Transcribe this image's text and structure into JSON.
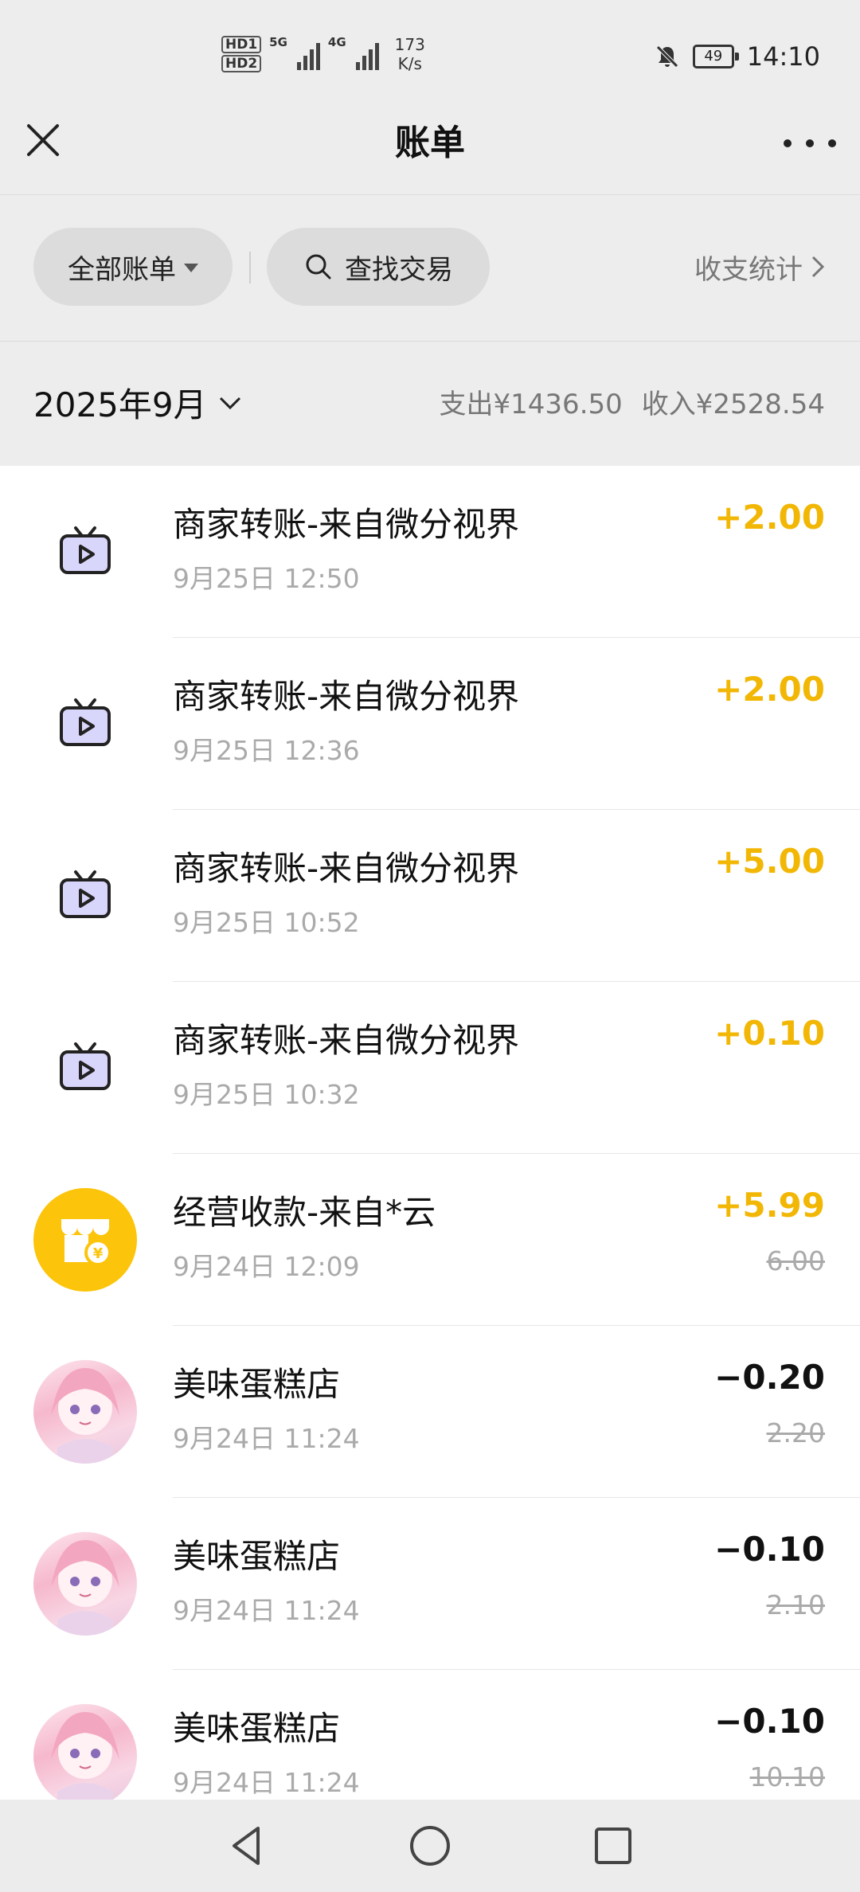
{
  "status_bar": {
    "hd1": "HD1",
    "hd2": "HD2",
    "net1": "5G",
    "net2": "4G",
    "speed_value": "173",
    "speed_unit": "K/s",
    "battery": "49",
    "time": "14:10"
  },
  "header": {
    "title": "账单"
  },
  "filters": {
    "all_bills": "全部账单",
    "search": "查找交易",
    "stats": "收支统计"
  },
  "summary": {
    "month": "2025年9月",
    "expense": "支出¥1436.50",
    "income": "收入¥2528.54"
  },
  "transactions": [
    {
      "name": "商家转账-来自微分视界",
      "time": "9月25日 12:50",
      "amount": "+2.00",
      "original": "",
      "icon": "tv-play-icon"
    },
    {
      "name": "商家转账-来自微分视界",
      "time": "9月25日 12:36",
      "amount": "+2.00",
      "original": "",
      "icon": "tv-play-icon"
    },
    {
      "name": "商家转账-来自微分视界",
      "time": "9月25日 10:52",
      "amount": "+5.00",
      "original": "",
      "icon": "tv-play-icon"
    },
    {
      "name": "商家转账-来自微分视界",
      "time": "9月25日 10:32",
      "amount": "+0.10",
      "original": "",
      "icon": "tv-play-icon"
    },
    {
      "name": "经营收款-来自*云",
      "time": "9月24日 12:09",
      "amount": "+5.99",
      "original": "6.00",
      "icon": "shop-yuan-icon"
    },
    {
      "name": "美味蛋糕店",
      "time": "9月24日 11:24",
      "amount": "−0.20",
      "original": "2.20",
      "icon": "avatar"
    },
    {
      "name": "美味蛋糕店",
      "time": "9月24日 11:24",
      "amount": "−0.10",
      "original": "2.10",
      "icon": "avatar"
    },
    {
      "name": "美味蛋糕店",
      "time": "9月24日 11:24",
      "amount": "−0.10",
      "original": "10.10",
      "icon": "avatar"
    }
  ],
  "colors": {
    "income": "#f2b705",
    "expense": "#111111",
    "shop_icon_bg": "#fcc40a",
    "tv_icon_fill": "#d9d6fb"
  }
}
